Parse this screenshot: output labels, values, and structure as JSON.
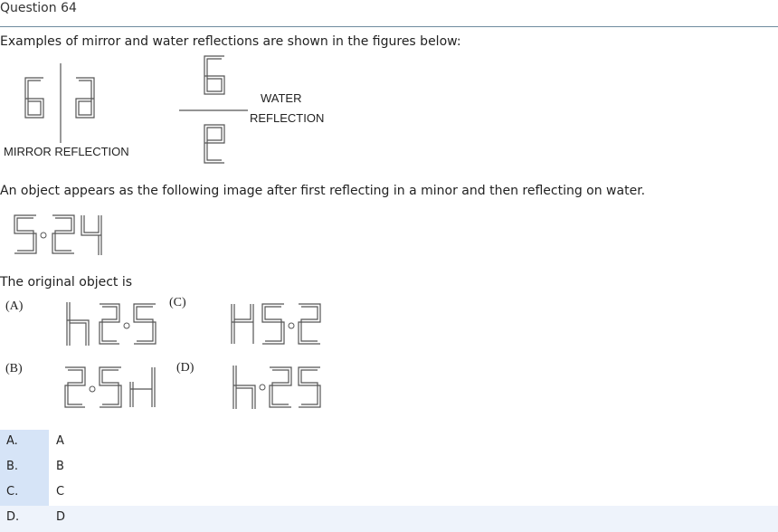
{
  "question": {
    "title": "Question 64",
    "intro": "Examples of mirror and water reflections are shown in the figures below:",
    "mirror_label": "MIRROR REFLECTION",
    "water_label_1": "WATER",
    "water_label_2": "REFLECTION",
    "prompt": "An object appears as the following image after first reflecting in a minor and then reflecting on water.",
    "original_label": "The original object is"
  },
  "figure_labels": {
    "a": "(A)",
    "b": "(B)",
    "c": "(C)",
    "d": "(D)"
  },
  "options": [
    {
      "key": "A.",
      "value": "A"
    },
    {
      "key": "B.",
      "value": "B"
    },
    {
      "key": "C.",
      "value": "C"
    },
    {
      "key": "D.",
      "value": "D"
    }
  ],
  "colors": {
    "option_key_bg": "#d6e4f7",
    "selected_row_bg": "#eef3fb",
    "title_rule": "#6f8c9f"
  }
}
